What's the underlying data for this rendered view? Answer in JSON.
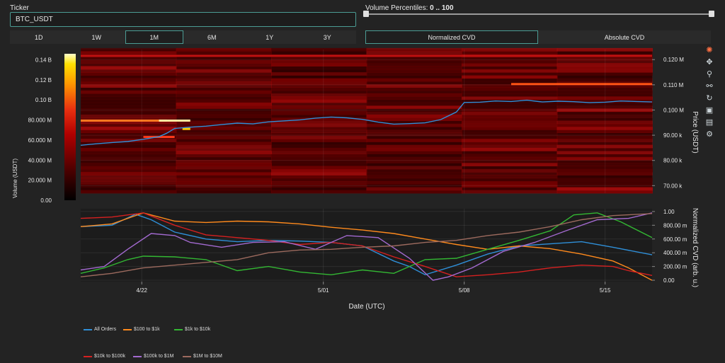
{
  "controls": {
    "ticker_label": "Ticker",
    "ticker_value": "BTC_USDT",
    "volume_label": "Volume Percentiles: ",
    "volume_value": "0 .. 100",
    "ranges": [
      {
        "label": "1D",
        "active": false
      },
      {
        "label": "1W",
        "active": false
      },
      {
        "label": "1M",
        "active": true
      },
      {
        "label": "6M",
        "active": false
      },
      {
        "label": "1Y",
        "active": false
      },
      {
        "label": "3Y",
        "active": false
      }
    ],
    "modes": [
      {
        "label": "Normalized CVD",
        "active": true
      },
      {
        "label": "Absolute CVD",
        "active": false
      }
    ]
  },
  "toolbar": [
    "logo-icon",
    "pan-icon",
    "zoom-icon",
    "lasso-icon",
    "reset-icon",
    "download-icon",
    "comment-icon",
    "settings-icon"
  ],
  "chart_data": [
    {
      "type": "heatmap",
      "title": "",
      "xlabel": "Date (UTC)",
      "ylabel": "Price (USDT)",
      "colorbar_label": "Volume (USDT)",
      "colorbar_ticks": [
        "0.00",
        "20.000 M",
        "40.000 M",
        "60.000 M",
        "80.000 M",
        "0.10 B",
        "0.12 B",
        "0.14 B"
      ],
      "colorbar_values": [
        0,
        20,
        40,
        60,
        80,
        100,
        120,
        140
      ],
      "colorscale": [
        "#000000",
        "#3a0000",
        "#8b0000",
        "#c81414",
        "#ff6a00",
        "#ffd000",
        "#ffffcc"
      ],
      "yticks": [
        "70.00 k",
        "80.00 k",
        "90.00 k",
        "0.100 M",
        "0.110 M",
        "0.120 M"
      ],
      "ytick_values": [
        70,
        80,
        90,
        100,
        110,
        120
      ],
      "ylim": [
        67,
        124
      ],
      "price_line_color": "#2f8fd8",
      "price_series": [
        {
          "x": 0,
          "y": 86.0
        },
        {
          "x": 2,
          "y": 86.6
        },
        {
          "x": 4,
          "y": 87.1
        },
        {
          "x": 6,
          "y": 87.5
        },
        {
          "x": 8,
          "y": 88.4
        },
        {
          "x": 10,
          "y": 89.4
        },
        {
          "x": 11,
          "y": 90.8
        },
        {
          "x": 12,
          "y": 92.7
        },
        {
          "x": 14,
          "y": 93.2
        },
        {
          "x": 16,
          "y": 93.6
        },
        {
          "x": 18,
          "y": 94.2
        },
        {
          "x": 20,
          "y": 94.8
        },
        {
          "x": 22,
          "y": 94.5
        },
        {
          "x": 24,
          "y": 95.3
        },
        {
          "x": 26,
          "y": 95.7
        },
        {
          "x": 28,
          "y": 96.1
        },
        {
          "x": 30,
          "y": 96.8
        },
        {
          "x": 32,
          "y": 97.2
        },
        {
          "x": 34,
          "y": 96.9
        },
        {
          "x": 36,
          "y": 96.3
        },
        {
          "x": 38,
          "y": 95.2
        },
        {
          "x": 40,
          "y": 94.4
        },
        {
          "x": 42,
          "y": 94.6
        },
        {
          "x": 44,
          "y": 94.9
        },
        {
          "x": 46,
          "y": 96.2
        },
        {
          "x": 48,
          "y": 99.2
        },
        {
          "x": 49,
          "y": 103.0
        },
        {
          "x": 51,
          "y": 103.1
        },
        {
          "x": 53,
          "y": 103.6
        },
        {
          "x": 55,
          "y": 103.4
        },
        {
          "x": 57,
          "y": 103.9
        },
        {
          "x": 59,
          "y": 103.2
        },
        {
          "x": 61,
          "y": 103.5
        },
        {
          "x": 63,
          "y": 103.3
        },
        {
          "x": 65,
          "y": 102.9
        },
        {
          "x": 67,
          "y": 103.1
        },
        {
          "x": 69,
          "y": 103.6
        },
        {
          "x": 71,
          "y": 103.4
        },
        {
          "x": 73,
          "y": 103.2
        }
      ],
      "x_days_range": [
        0,
        73
      ]
    },
    {
      "type": "line",
      "title": "",
      "xlabel": "Date (UTC)",
      "ylabel": "Normalized CVD (arb. u.)",
      "yticks": [
        "0.00",
        "200.00 m",
        "400.00 m",
        "600.00 m",
        "800.00 m",
        "1.00"
      ],
      "ytick_values": [
        0,
        0.2,
        0.4,
        0.6,
        0.8,
        1.0
      ],
      "ylim": [
        -0.02,
        1.04
      ],
      "xticks": [
        "4/22",
        "5/01",
        "5/08",
        "5/15"
      ],
      "xtick_values": [
        7.8,
        31.0,
        49.0,
        67.0
      ],
      "x_days_range": [
        0,
        73
      ],
      "legend_position": "bottom-left",
      "series": [
        {
          "name": "All Orders",
          "color": "#2f8fd8",
          "x": [
            0,
            4,
            7,
            9,
            12,
            16,
            20,
            24,
            28,
            32,
            36,
            40,
            42,
            44,
            48,
            52,
            56,
            60,
            64,
            68,
            73
          ],
          "y": [
            0.78,
            0.8,
            0.96,
            0.88,
            0.7,
            0.6,
            0.56,
            0.58,
            0.57,
            0.55,
            0.5,
            0.28,
            0.2,
            0.08,
            0.22,
            0.38,
            0.5,
            0.53,
            0.56,
            0.48,
            0.37
          ]
        },
        {
          "name": "$100 to $1k",
          "color": "#ff8a1c",
          "x": [
            0,
            4,
            8,
            12,
            16,
            20,
            24,
            28,
            32,
            36,
            40,
            44,
            48,
            52,
            56,
            60,
            64,
            68,
            70,
            73
          ],
          "y": [
            0.78,
            0.82,
            0.98,
            0.86,
            0.84,
            0.86,
            0.85,
            0.82,
            0.77,
            0.73,
            0.68,
            0.6,
            0.52,
            0.45,
            0.5,
            0.46,
            0.38,
            0.28,
            0.18,
            0.0
          ]
        },
        {
          "name": "$1k to $10k",
          "color": "#33b833",
          "x": [
            0,
            3,
            6,
            8,
            12,
            16,
            20,
            24,
            28,
            32,
            36,
            40,
            44,
            48,
            52,
            56,
            60,
            63,
            66,
            69,
            73
          ],
          "y": [
            0.1,
            0.18,
            0.3,
            0.35,
            0.34,
            0.3,
            0.14,
            0.2,
            0.12,
            0.08,
            0.15,
            0.1,
            0.3,
            0.32,
            0.45,
            0.58,
            0.72,
            0.95,
            0.98,
            0.85,
            0.62
          ]
        },
        {
          "name": "$10k to $100k",
          "color": "#d62020",
          "x": [
            0,
            4,
            8,
            12,
            16,
            20,
            24,
            28,
            32,
            36,
            40,
            44,
            48,
            52,
            56,
            60,
            64,
            68,
            70,
            73
          ],
          "y": [
            0.9,
            0.92,
            0.98,
            0.8,
            0.66,
            0.62,
            0.58,
            0.52,
            0.55,
            0.5,
            0.34,
            0.2,
            0.05,
            0.08,
            0.12,
            0.18,
            0.22,
            0.2,
            0.14,
            0.07
          ]
        },
        {
          "name": "$100k to $1M",
          "color": "#a36ad0",
          "x": [
            0,
            3,
            6,
            9,
            12,
            14,
            18,
            22,
            26,
            30,
            34,
            38,
            42,
            45,
            47,
            50,
            54,
            58,
            62,
            66,
            70,
            73
          ],
          "y": [
            0.15,
            0.2,
            0.45,
            0.68,
            0.65,
            0.55,
            0.48,
            0.55,
            0.56,
            0.45,
            0.65,
            0.62,
            0.32,
            0.0,
            0.05,
            0.18,
            0.42,
            0.55,
            0.72,
            0.88,
            0.9,
            0.98
          ]
        },
        {
          "name": "$1M to $10M",
          "color": "#9c6a5e",
          "x": [
            0,
            4,
            8,
            12,
            16,
            20,
            24,
            28,
            32,
            36,
            40,
            44,
            48,
            52,
            56,
            60,
            64,
            68,
            73
          ],
          "y": [
            0.05,
            0.1,
            0.18,
            0.22,
            0.26,
            0.3,
            0.4,
            0.44,
            0.45,
            0.48,
            0.5,
            0.55,
            0.58,
            0.65,
            0.7,
            0.78,
            0.88,
            0.94,
            0.97
          ]
        }
      ]
    }
  ]
}
